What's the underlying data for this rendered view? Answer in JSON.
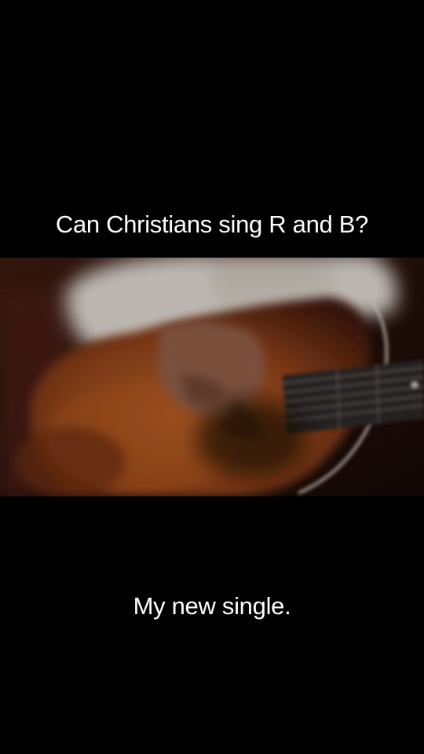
{
  "captions": {
    "top": "Can Christians sing R and B?",
    "bottom": "My new single."
  },
  "photo": {
    "subject": "blurred-guitar-player",
    "colors": {
      "background": "#000000",
      "backdrop": "#1a0c07",
      "shirt": "#d8d2cc",
      "guitar_body": "#9a4a1e",
      "hand": "#8a5a44",
      "fretboard": "#2c2726"
    }
  }
}
